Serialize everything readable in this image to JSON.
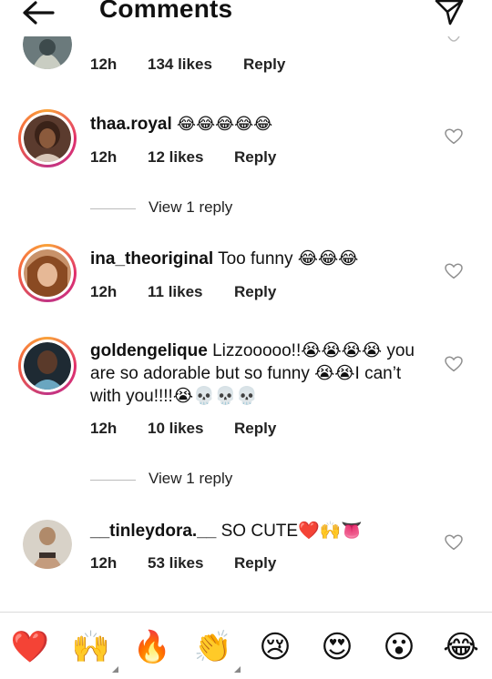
{
  "header": {
    "title": "Comments",
    "back_icon": "back-arrow-icon",
    "send_icon": "send-icon"
  },
  "comments": [
    {
      "meta": {
        "time": "12h",
        "likes": "134 likes",
        "reply": "Reply"
      }
    },
    {
      "username": "thaa.royal",
      "text": "😂😂😂😂😂",
      "meta": {
        "time": "12h",
        "likes": "12 likes",
        "reply": "Reply"
      },
      "view_reply": "View 1 reply"
    },
    {
      "username": "ina_theoriginal",
      "text": "Too funny 😂😂😂",
      "meta": {
        "time": "12h",
        "likes": "11 likes",
        "reply": "Reply"
      }
    },
    {
      "username": "goldengelique",
      "text": "Lizzooooo!!😭😭😭😭 you are so adorable but so funny 😭😭I can’t with you!!!!😭💀💀💀",
      "meta": {
        "time": "12h",
        "likes": "10 likes",
        "reply": "Reply"
      },
      "view_reply": "View 1 reply"
    },
    {
      "username": "__tinleydora.__",
      "text": "SO CUTE❤️🙌👅",
      "meta": {
        "time": "12h",
        "likes": "53 likes",
        "reply": "Reply"
      }
    }
  ],
  "reactions": [
    "❤️",
    "🙌",
    "🔥",
    "👏",
    "😢",
    "😍",
    "😮",
    "😂"
  ],
  "colors": {
    "story_ring_start": "#f9a23a",
    "story_ring_mid": "#e1306c",
    "heart_outline": "#8e8e8e",
    "divider": "#dbdbdb"
  }
}
